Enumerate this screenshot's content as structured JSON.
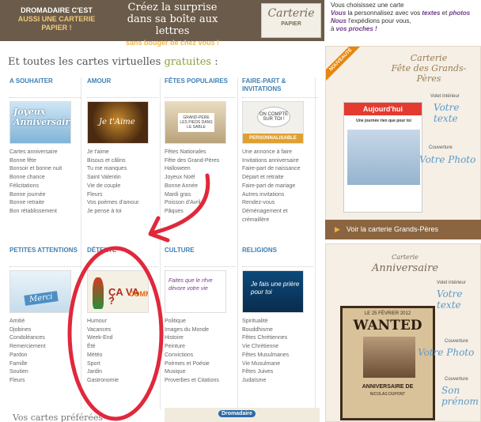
{
  "banner": {
    "left_line1": "DROMADAIRE C'EST",
    "left_line2": "AUSSI UNE CARTERIE",
    "left_line3": "PAPIER !",
    "mid_line1": "Créez la surprise",
    "mid_line2": "dans sa boîte aux lettres",
    "mid_small": "sans bouger de chez vous !",
    "card_title": "Carterie",
    "card_sub": "PAPIER"
  },
  "right_top": {
    "line1": "Vous choisissez une carte",
    "line2a": "Vous",
    "line2b": " la personnalisez avec vos ",
    "line2c": "textes",
    "line2d": " et ",
    "line2e": "photos",
    "line3a": "Nous",
    "line3b": " l'expédions pour vous,",
    "line4a": "à ",
    "line4b": "vos proches !"
  },
  "main": {
    "title_prefix": "Et toutes les cartes virtuelles ",
    "title_green": "gratuites",
    "title_suffix": " :"
  },
  "categories": [
    {
      "title": "A SOUHAITER",
      "img_text": "Joyeux Anniversaire",
      "items": [
        "Cartes anniversaire",
        "Bonne fête",
        "Bonsoir et bonne nuit",
        "Bonne chance",
        "Félicitations",
        "Bonne journée",
        "Bonne retraite",
        "Bon rétablissement"
      ]
    },
    {
      "title": "AMOUR",
      "img_text": "Je t'Aime",
      "items": [
        "Je t'aime",
        "Bisous et câlins",
        "Tu me manques",
        "Saint Valentin",
        "Vie de couple",
        "Fleurs",
        "Vos poèmes d'amour",
        "Je pense à toi"
      ]
    },
    {
      "title": "FÊTES POPULAIRES",
      "img_text": "GRAND-PÈRE LES PIEDS DANS LE SABLE",
      "items": [
        "Fêtes Nationales",
        "Fête des Grand-Pères",
        "Halloween",
        "Joyeux Noël",
        "Bonne Année",
        "Mardi gras",
        "Poisson d'Avril",
        "Pâques"
      ]
    },
    {
      "title": "FAIRE-PART & INVITATIONS",
      "img_text": "ON COMPTE SUR TOI !",
      "img_banner": "PERSONNALISABLE",
      "items": [
        "Une annonce à faire",
        "Invitations anniversaire",
        "Faire-part de naissance",
        "Départ et retraite",
        "Faire-part de mariage",
        "Autres invitations",
        "Rendez-vous",
        "Déménagement et",
        "crémaillère"
      ]
    },
    {
      "title": "PETITES ATTENTIONS",
      "img_text": "Merci",
      "items": [
        "Amitié",
        "Djobines",
        "Condoléances",
        "Remerciement",
        "Pardon",
        "Famille",
        "Soutien",
        "Fleurs"
      ]
    },
    {
      "title": "DÉTENTE",
      "img_text_a": "COMMENT",
      "img_text_b": "ÇA VA ?",
      "items": [
        "Humour",
        "Vacances",
        "Week-End",
        "Été",
        "Météo",
        "Sport",
        "Jardin",
        "Gastronomie"
      ]
    },
    {
      "title": "CULTURE",
      "img_text": "Faites que le rêve dévore votre vie",
      "items": [
        "Politique",
        "Images du Monde",
        "Histoire",
        "Peinture",
        "Convictions",
        "Poèmes et Poésie",
        "Musique",
        "Proverbes et Citations"
      ]
    },
    {
      "title": "RELIGIONS",
      "img_text": "Je fais une prière pour toi",
      "items": [
        "Spiritualité",
        "Bouddhisme",
        "Fêtes Chrétiennes",
        "Vie Chrétienne",
        "Fêtes Musulmanes",
        "Vie Musulmane",
        "Fêtes Juives",
        "Judaïsme"
      ]
    }
  ],
  "bottom": {
    "title": "Vos cartes préférées",
    "logo": "Dromadaire"
  },
  "ad1": {
    "ribbon": "NOUVEAUTÉ",
    "title_a": "Carterie",
    "title_b": "Fête des Grands-Pères",
    "paper_head": "Aujourd'hui",
    "paper_line": "Une journée rien que pour toi",
    "volet_label": "Volet intérieur",
    "volet_script": "Votre texte",
    "cover_label": "Couverture",
    "cover_script": "Votre Photo",
    "bar_text": "Voir la carterie Grands-Pères"
  },
  "ad2": {
    "title_a": "Carterie",
    "title_b": "Anniversaire",
    "wanted_date": "LE 25 FÉVRIER 2012",
    "wanted_title": "WANTED",
    "wanted_sub": "ANNIVERSAIRE DE",
    "wanted_name": "NICOLAS DUPONT",
    "volet_label": "Volet intérieur",
    "volet_script": "Votre texte",
    "cover_label": "Couverture",
    "cover_script": "Votre Photo",
    "cover2_label": "Couverture",
    "cover2_script": "Son prénom"
  },
  "colors": {
    "brand_brown": "#6b5b4a",
    "link_blue": "#3f7fb3",
    "green": "#8aa23a",
    "annotation_red": "#e0283c"
  }
}
